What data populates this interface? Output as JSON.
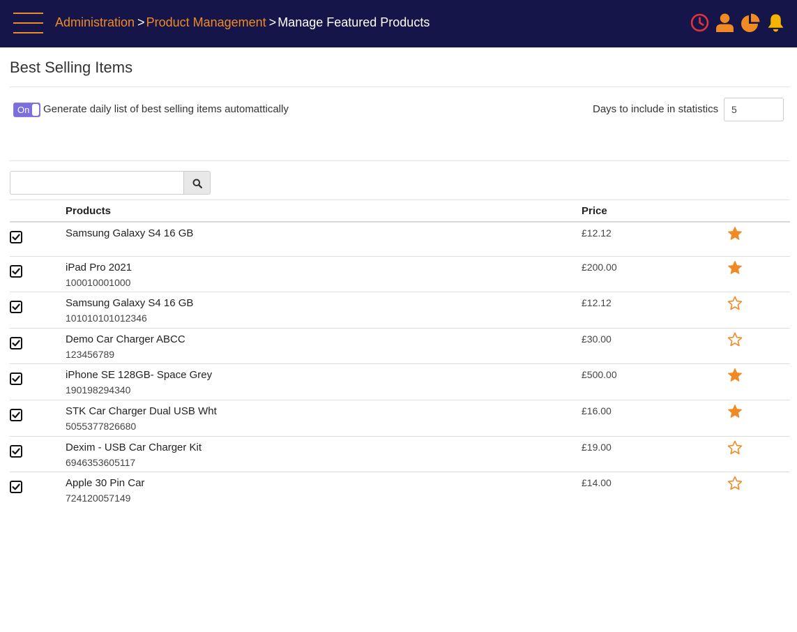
{
  "header": {
    "breadcrumb": {
      "items": [
        "Administration",
        "Product Management",
        "Manage Featured Products"
      ],
      "separator": ">"
    },
    "icons": [
      "clock-icon",
      "user-icon",
      "pie-chart-icon",
      "bell-icon"
    ]
  },
  "page": {
    "title": "Best Selling Items"
  },
  "settings": {
    "toggle_state": "On",
    "toggle_label": "Generate daily list of best selling items automattically",
    "days_label": "Days to include in statistics",
    "days_value": "5"
  },
  "search": {
    "value": "",
    "button_icon": "search-icon"
  },
  "table": {
    "columns": [
      "Products",
      "Price"
    ],
    "rows": [
      {
        "name": "Samsung Galaxy S4 16 GB",
        "sku": "",
        "price": "£12.12",
        "checked": true,
        "featured": true
      },
      {
        "name": "iPad Pro 2021",
        "sku": "100010001000",
        "price": "£200.00",
        "checked": true,
        "featured": true
      },
      {
        "name": "Samsung Galaxy S4 16 GB",
        "sku": "101010101012346",
        "price": "£12.12",
        "checked": true,
        "featured": false
      },
      {
        "name": "Demo Car Charger ABCC",
        "sku": "123456789",
        "price": "£30.00",
        "checked": true,
        "featured": false
      },
      {
        "name": "iPhone SE 128GB- Space Grey",
        "sku": "190198294340",
        "price": "£500.00",
        "checked": true,
        "featured": true
      },
      {
        "name": "STK Car Charger Dual USB Wht",
        "sku": "5055377826680",
        "price": "£16.00",
        "checked": true,
        "featured": true
      },
      {
        "name": "Dexim - USB Car Charger Kit",
        "sku": "6946353605117",
        "price": "£19.00",
        "checked": true,
        "featured": false
      },
      {
        "name": "Apple 30 Pin Car",
        "sku": "724120057149",
        "price": "£14.00",
        "checked": true,
        "featured": false
      }
    ]
  },
  "colors": {
    "header_bg": "#15154a",
    "accent": "#f08a24",
    "clock": "#d9343f",
    "toggle": "#7b6fe0"
  }
}
